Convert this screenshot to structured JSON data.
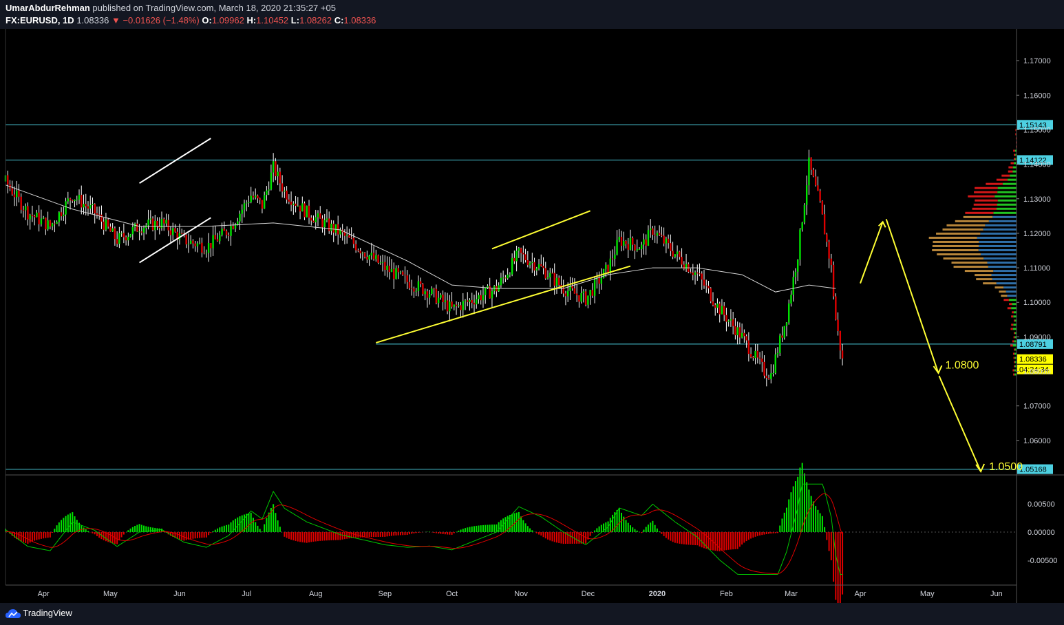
{
  "header": {
    "author": "UmarAbdurRehman",
    "published_text": " published on TradingView.com, March 18, 2020 21:35:27 +05",
    "symbol": "FX:EURUSD, 1D",
    "last": "1.08336",
    "change": "−0.01626 (−1.48%)",
    "o_label": "O:",
    "o_value": "1.09962",
    "h_label": "H:",
    "h_value": "1.10452",
    "l_label": "L:",
    "l_value": "1.08262",
    "c_label": "C:",
    "c_value": "1.08336"
  },
  "footer": {
    "brand": "TradingView"
  },
  "colors": {
    "up": "#00e600",
    "down": "#e00000",
    "trend": "#ffff33",
    "channel": "#ffffff",
    "level_line": "#4dd0e1",
    "ma": "#d8d8d8",
    "macd": "#00c800",
    "signal": "#e00000",
    "background": "#000000"
  },
  "chart_data": {
    "type": "candlestick",
    "symbol": "FX:EURUSD",
    "timeframe": "1D",
    "ylim": [
      1.05,
      1.178
    ],
    "y_ticks": [
      "1.17000",
      "1.16000",
      "1.15000",
      "1.14000",
      "1.13000",
      "1.12000",
      "1.11000",
      "1.10000",
      "1.09000",
      "1.08000",
      "1.07000",
      "1.06000"
    ],
    "y_tick_values": [
      1.17,
      1.16,
      1.15,
      1.14,
      1.13,
      1.12,
      1.11,
      1.1,
      1.09,
      1.08,
      1.07,
      1.06
    ],
    "x_months": [
      "Apr",
      "May",
      "Jun",
      "Jul",
      "Aug",
      "Sep",
      "Oct",
      "Nov",
      "Dec",
      "2020",
      "Feb",
      "Mar",
      "Apr",
      "May",
      "Jun"
    ],
    "x_month_days": [
      17,
      47,
      78,
      108,
      139,
      170,
      200,
      231,
      261,
      292,
      323,
      352,
      383,
      413,
      444
    ],
    "x_range_days": [
      0,
      453
    ],
    "price_series": [
      [
        0,
        1.135
      ],
      [
        10,
        1.126
      ],
      [
        20,
        1.122
      ],
      [
        30,
        1.131
      ],
      [
        40,
        1.126
      ],
      [
        50,
        1.118
      ],
      [
        60,
        1.122
      ],
      [
        70,
        1.123
      ],
      [
        80,
        1.118
      ],
      [
        90,
        1.116
      ],
      [
        100,
        1.121
      ],
      [
        110,
        1.131
      ],
      [
        115,
        1.128
      ],
      [
        120,
        1.139
      ],
      [
        125,
        1.132
      ],
      [
        130,
        1.129
      ],
      [
        135,
        1.126
      ],
      [
        140,
        1.124
      ],
      [
        150,
        1.12
      ],
      [
        160,
        1.115
      ],
      [
        170,
        1.11
      ],
      [
        180,
        1.106
      ],
      [
        190,
        1.103
      ],
      [
        200,
        1.098
      ],
      [
        210,
        1.101
      ],
      [
        220,
        1.104
      ],
      [
        230,
        1.114
      ],
      [
        240,
        1.11
      ],
      [
        250,
        1.104
      ],
      [
        260,
        1.101
      ],
      [
        270,
        1.11
      ],
      [
        275,
        1.118
      ],
      [
        285,
        1.116
      ],
      [
        290,
        1.121
      ],
      [
        300,
        1.114
      ],
      [
        310,
        1.108
      ],
      [
        320,
        1.098
      ],
      [
        330,
        1.09
      ],
      [
        340,
        1.08
      ],
      [
        343,
        1.079
      ],
      [
        350,
        1.096
      ],
      [
        355,
        1.114
      ],
      [
        360,
        1.14
      ],
      [
        365,
        1.128
      ],
      [
        370,
        1.11
      ],
      [
        372,
        1.095
      ],
      [
        375,
        1.083
      ]
    ],
    "moving_average": [
      [
        0,
        1.134
      ],
      [
        30,
        1.127
      ],
      [
        60,
        1.122
      ],
      [
        90,
        1.122
      ],
      [
        120,
        1.123
      ],
      [
        150,
        1.121
      ],
      [
        180,
        1.112
      ],
      [
        200,
        1.105
      ],
      [
        220,
        1.104
      ],
      [
        250,
        1.104
      ],
      [
        270,
        1.108
      ],
      [
        290,
        1.11
      ],
      [
        310,
        1.11
      ],
      [
        330,
        1.108
      ],
      [
        345,
        1.103
      ],
      [
        360,
        1.105
      ],
      [
        372,
        1.104
      ]
    ],
    "levels": [
      {
        "value": 1.15143,
        "label": "1.15143"
      },
      {
        "value": 1.14122,
        "label": "1.14122"
      },
      {
        "value": 1.08791,
        "label": "1.08791"
      },
      {
        "value": 1.05168,
        "label": "1.05168"
      }
    ],
    "last_price_label": "1.08336",
    "last_price_value": 1.08336,
    "countdown": "04:24:34",
    "trendlines": [
      {
        "from": [
          218,
          1.1155
        ],
        "to": [
          262,
          1.1265
        ]
      },
      {
        "from": [
          166,
          1.0883
        ],
        "to": [
          280,
          1.1105
        ]
      },
      {
        "from": [
          60,
          1.1345
        ],
        "to": [
          92,
          1.1475
        ]
      },
      {
        "from": [
          60,
          1.1115
        ],
        "to": [
          92,
          1.1245
        ]
      }
    ],
    "annotations": [
      {
        "text": "1.0800",
        "value": 1.08
      },
      {
        "text": "1.0500",
        "value": 1.05
      }
    ],
    "macd_y_ticks": [
      "0.00500",
      "0.00000",
      "-0.00500"
    ],
    "macd_y_values": [
      0.005,
      0,
      -0.005
    ]
  }
}
